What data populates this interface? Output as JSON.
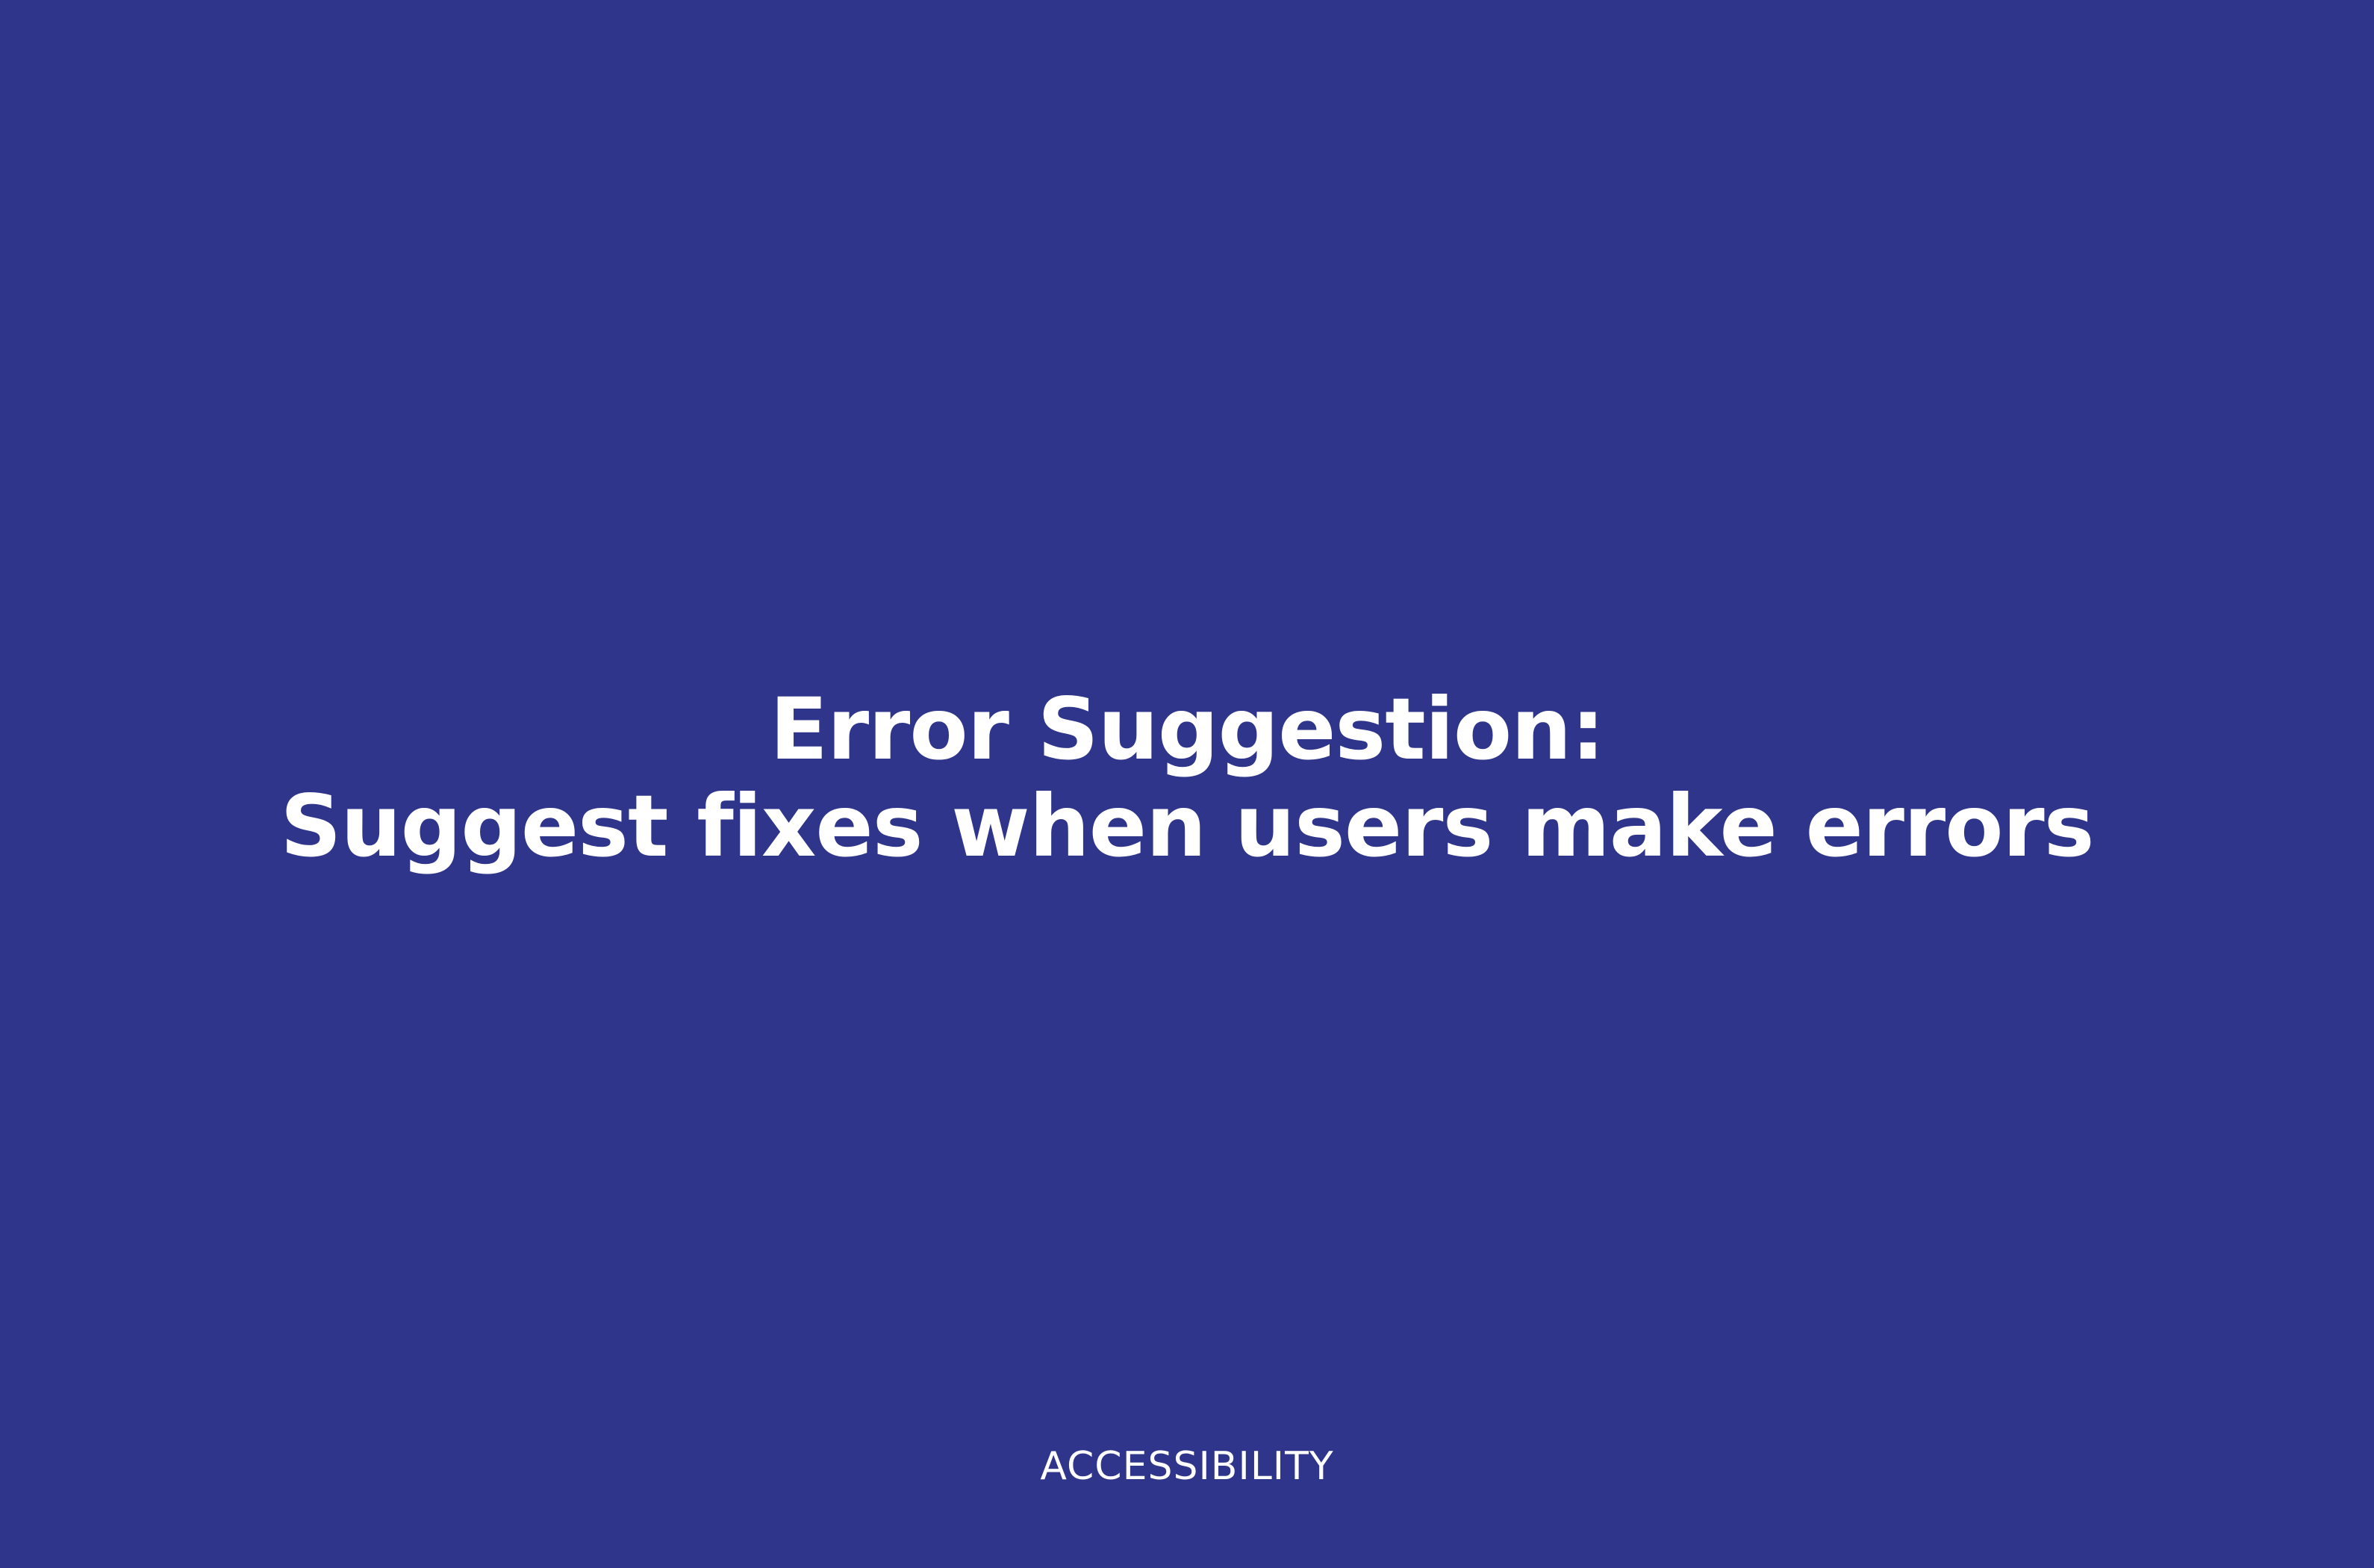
{
  "slide": {
    "background_color": "#2f358a",
    "text_color": "#ffffff",
    "title_line_1": "Error Suggestion:",
    "title_line_2": "Suggest fixes when users make errors",
    "footer_label": "ACCESSIBILITY"
  }
}
